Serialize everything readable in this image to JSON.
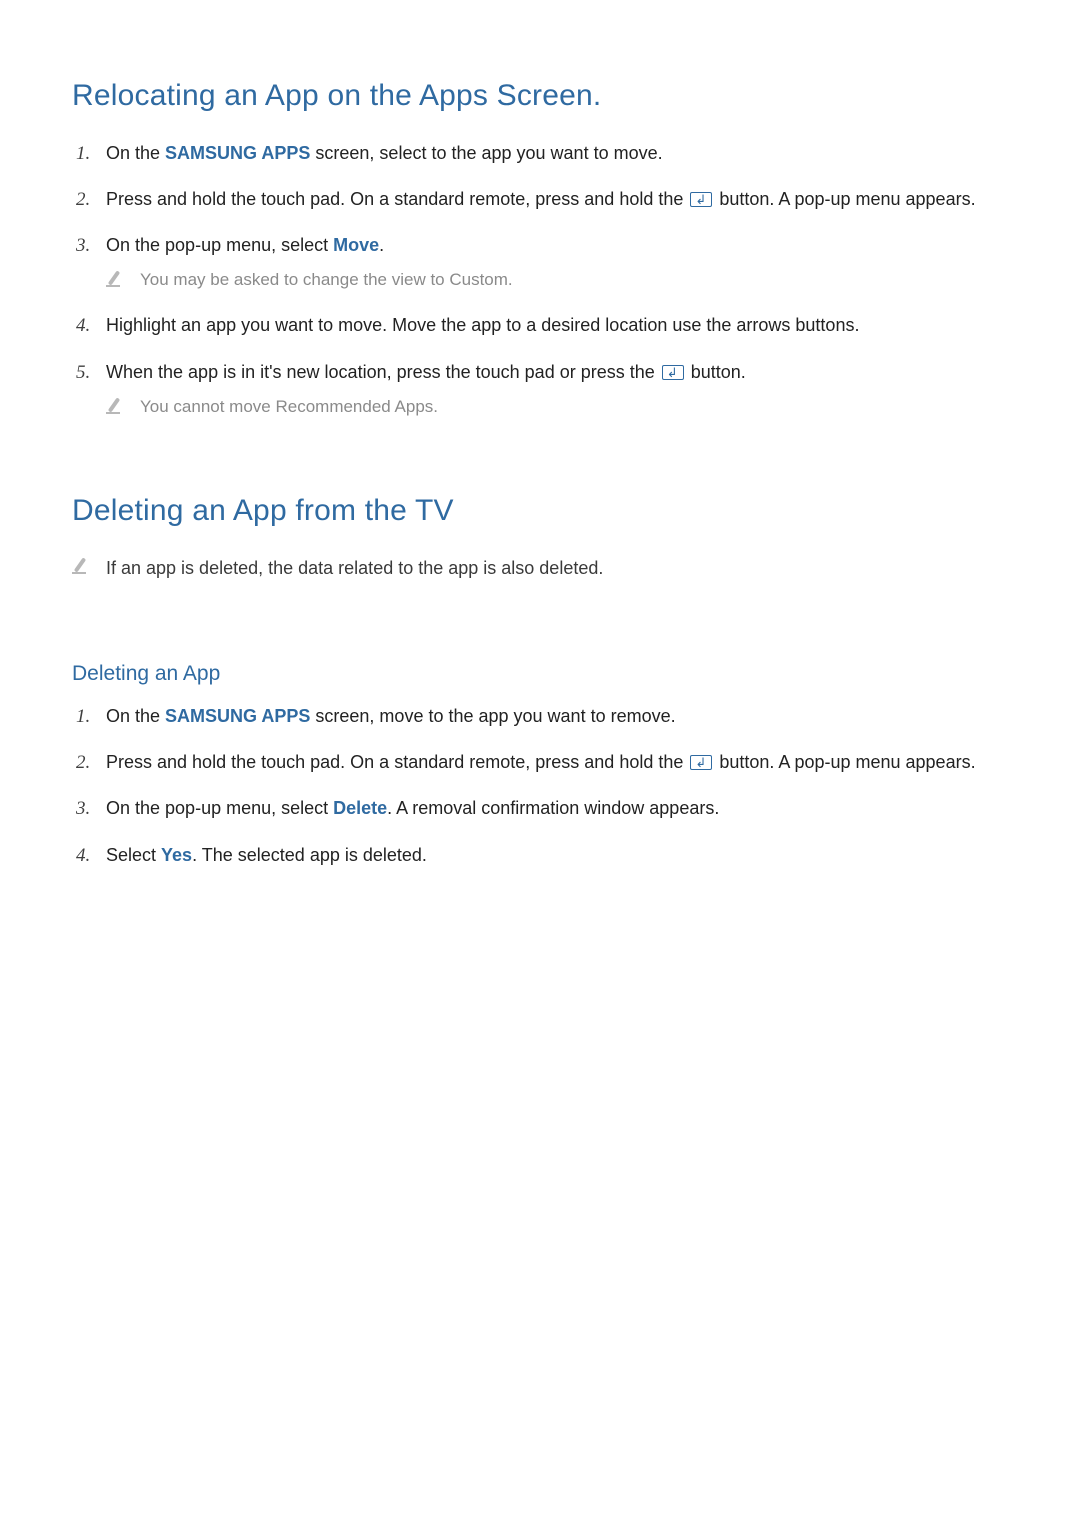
{
  "heading_relocate": "Relocating an App on the Apps Screen.",
  "r1": {
    "a": "On the ",
    "b": "SAMSUNG APPS",
    "c": " screen, select to the app you want to move."
  },
  "r2": {
    "a": "Press and hold the touch pad. On a standard remote, press and hold the ",
    "b": " button. A pop-up menu appears."
  },
  "r3": {
    "a": "On the pop-up menu, select ",
    "b": "Move",
    "c": "."
  },
  "r3_note": "You may be asked to change the view to Custom.",
  "r4": "Highlight an app you want to move. Move the app to a desired location use the arrows buttons.",
  "r5": {
    "a": "When the app is in it's new location, press the touch pad or press the ",
    "b": " button."
  },
  "r5_note": "You cannot move Recommended Apps.",
  "heading_delete": "Deleting an App from the TV",
  "delete_note": "If an app is deleted, the data related to the app is also deleted.",
  "subheading_delete": "Deleting an App",
  "d1": {
    "a": "On the ",
    "b": "SAMSUNG APPS",
    "c": " screen, move to the app you want to remove."
  },
  "d2": {
    "a": "Press and hold the touch pad. On a standard remote, press and hold the ",
    "b": " button. A pop-up menu appears."
  },
  "d3": {
    "a": "On the pop-up menu, select ",
    "b": "Delete",
    "c": ". A removal confirmation window appears."
  },
  "d4": {
    "a": "Select ",
    "b": "Yes",
    "c": ". The selected app is deleted."
  }
}
